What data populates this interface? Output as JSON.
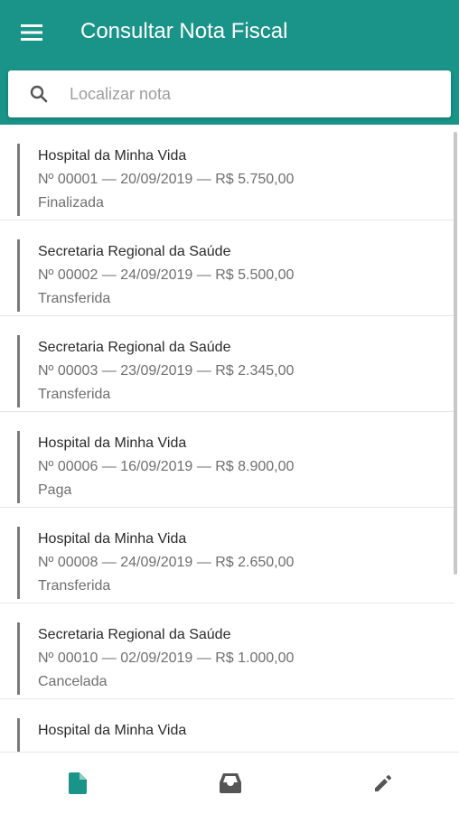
{
  "app": {
    "title": "Consultar Nota Fiscal",
    "primary_color": "#1a9488"
  },
  "search": {
    "placeholder": "Localizar nota",
    "value": ""
  },
  "notes": [
    {
      "name": "Hospital da Minha Vida",
      "detail": "Nº 00001 — 20/09/2019 — R$ 5.750,00",
      "status": "Finalizada"
    },
    {
      "name": "Secretaria Regional da Saúde",
      "detail": "Nº 00002 — 24/09/2019 — R$ 5.500,00",
      "status": "Transferida"
    },
    {
      "name": "Secretaria Regional da Saúde",
      "detail": "Nº 00003 — 23/09/2019 — R$ 2.345,00",
      "status": "Transferida"
    },
    {
      "name": "Hospital da Minha Vida",
      "detail": "Nº 00006 — 16/09/2019 — R$ 8.900,00",
      "status": "Paga"
    },
    {
      "name": "Hospital da Minha Vida",
      "detail": "Nº 00008 — 24/09/2019 — R$ 2.650,00",
      "status": "Transferida"
    },
    {
      "name": "Secretaria Regional da Saúde",
      "detail": "Nº 00010 — 02/09/2019 — R$ 1.000,00",
      "status": "Cancelada"
    },
    {
      "name": "Hospital da Minha Vida",
      "detail": "",
      "status": ""
    }
  ],
  "bottom_nav": [
    {
      "icon": "document-icon",
      "active": true
    },
    {
      "icon": "inbox-icon",
      "active": false
    },
    {
      "icon": "pencil-icon",
      "active": false
    }
  ]
}
